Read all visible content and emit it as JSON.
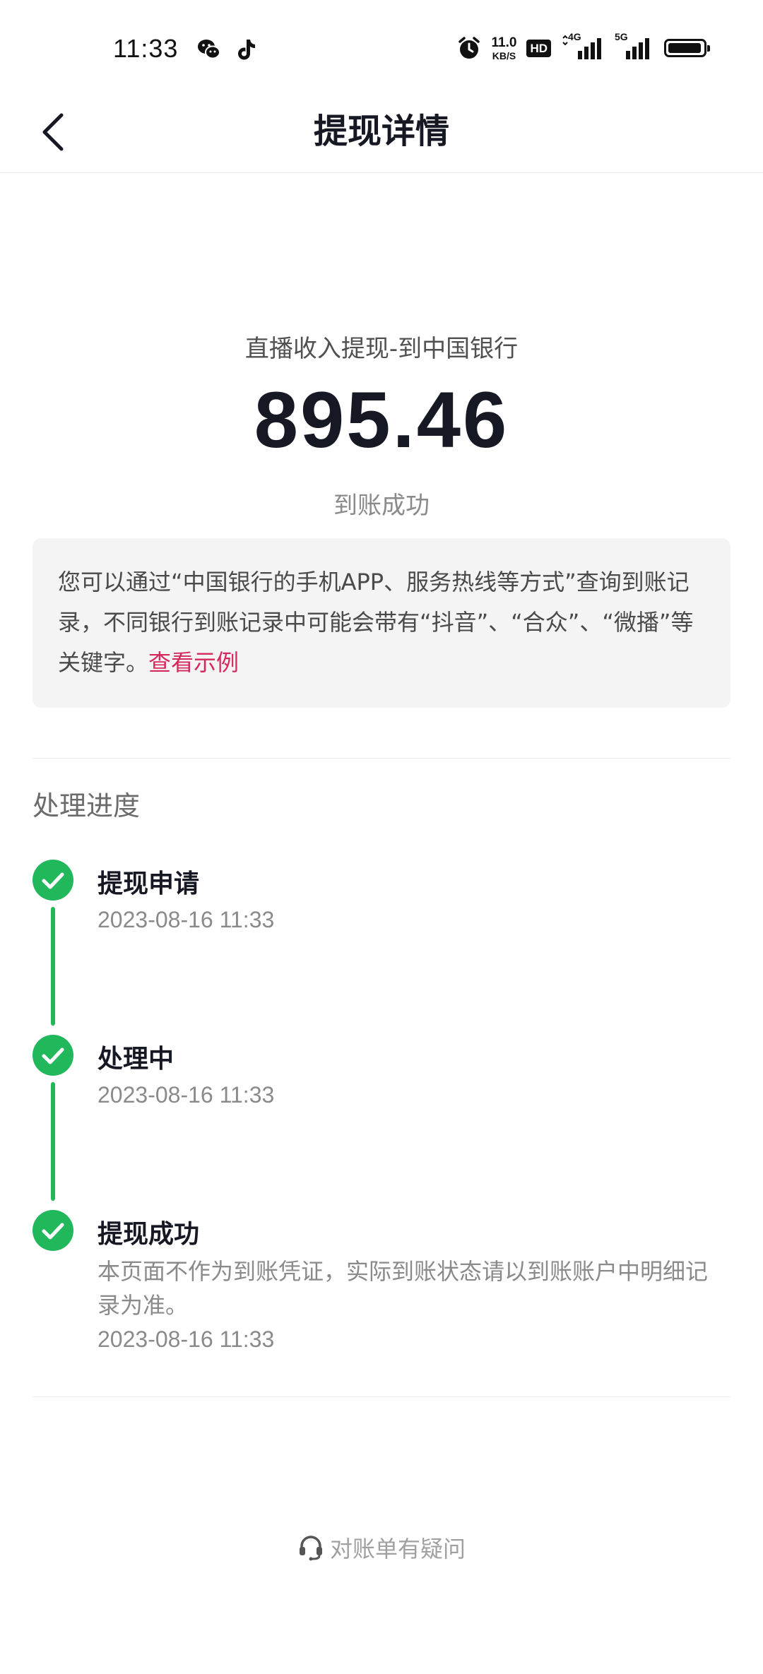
{
  "status_bar": {
    "time": "11:33",
    "network_speed": "11.0",
    "network_speed_unit": "KB/S",
    "hd_label": "HD",
    "network_1": "4G",
    "network_2": "5G",
    "battery_level": 0.95
  },
  "nav": {
    "title": "提现详情"
  },
  "summary": {
    "subtitle": "直播收入提现-到中国银行",
    "amount": "895.46",
    "status": "到账成功"
  },
  "notice": {
    "text": "您可以通过“中国银行的手机APP、服务热线等方式”查询到账记录，不同银行到账记录中可能会带有“抖音”、“合众”、“微播”等关键字。",
    "link_label": "查看示例"
  },
  "progress": {
    "title": "处理进度",
    "steps": [
      {
        "title": "提现申请",
        "description": "",
        "time": "2023-08-16 11:33"
      },
      {
        "title": "处理中",
        "description": "",
        "time": "2023-08-16 11:33"
      },
      {
        "title": "提现成功",
        "description": "本页面不作为到账凭证，实际到账状态请以到账账户中明细记录为准。",
        "time": "2023-08-16 11:33"
      }
    ]
  },
  "footer": {
    "help_label": "对账单有疑问"
  },
  "colors": {
    "success_green": "#21b85c",
    "link_red": "#d5285c"
  }
}
